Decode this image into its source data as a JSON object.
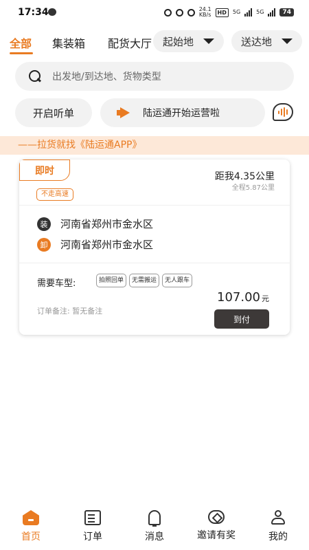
{
  "status_bar": {
    "time": "17:34",
    "net_speed_top": "24.1",
    "net_speed_unit": "KB/s",
    "hd_label": "HD",
    "sig1_label": "5G",
    "sig2_label": "5G",
    "battery": "74"
  },
  "tabs": [
    {
      "label": "全部",
      "active": true
    },
    {
      "label": "集装箱",
      "active": false
    },
    {
      "label": "配货大厅",
      "active": false
    }
  ],
  "filters": {
    "origin_label": "起始地",
    "destination_label": "送达地"
  },
  "search": {
    "placeholder": "出发地/到达地、货物类型"
  },
  "listen_button_label": "开启听单",
  "notice_text": "陆运通开始运营啦",
  "slogan": "——拉货就找《陆运通APP》",
  "order": {
    "timing_badge": "即时",
    "route_tag": "不走高速",
    "distance_text": "距我4.35公里",
    "total_distance_text": "全程5.87公里",
    "load": {
      "icon_char": "装",
      "address": "河南省郑州市金水区"
    },
    "unload": {
      "icon_char": "卸",
      "address": "河南省郑州市金水区"
    },
    "vehicle_label": "需要车型:",
    "tags": [
      "拍照回单",
      "无需搬运",
      "无人跟车"
    ],
    "remark": "订单备注: 暂无备注",
    "price_value": "107.00",
    "price_unit": "元",
    "pay_label": "到付"
  },
  "colors": {
    "accent": "#e97b22",
    "banner_bg": "#fde8d8",
    "pay_button": "#3d3938"
  },
  "bottom_nav": [
    {
      "label": "首页",
      "icon": "home-icon",
      "active": true
    },
    {
      "label": "订单",
      "icon": "order-list-icon",
      "active": false
    },
    {
      "label": "消息",
      "icon": "bell-icon",
      "active": false
    },
    {
      "label": "邀请有奖",
      "icon": "invite-icon",
      "active": false
    },
    {
      "label": "我的",
      "icon": "profile-icon",
      "active": false
    }
  ]
}
